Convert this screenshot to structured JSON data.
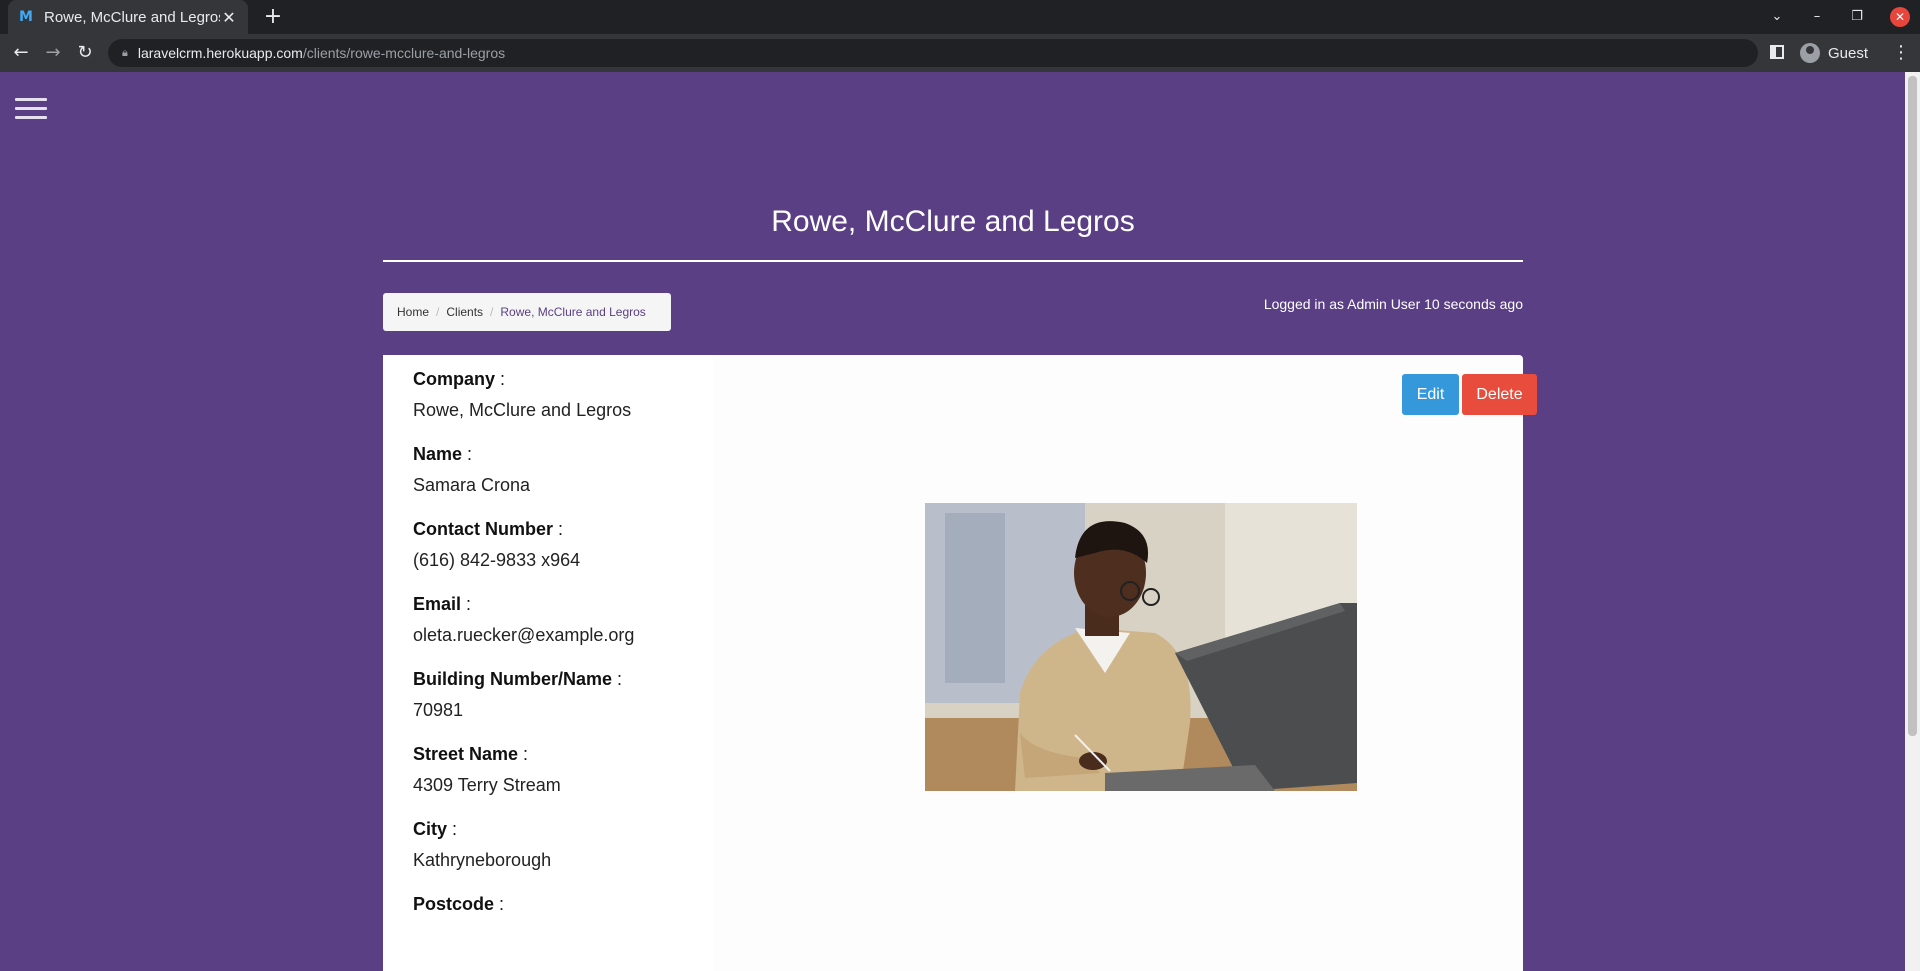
{
  "browser": {
    "tab_title": "Rowe, McClure and Legros",
    "favicon": "M",
    "url_host": "laravelcrm.herokuapp.com",
    "url_path": "/clients/rowe-mcclure-and-legros",
    "profile_name": "Guest"
  },
  "page": {
    "title": "Rowe, McClure and Legros",
    "breadcrumb": [
      {
        "label": "Home"
      },
      {
        "label": "Clients"
      },
      {
        "label": "Rowe, McClure and Legros"
      }
    ],
    "login_status": "Logged in as Admin User 10 seconds ago"
  },
  "client": {
    "fields": [
      {
        "label": "Company",
        "value": "Rowe, McClure and Legros"
      },
      {
        "label": "Name",
        "value": "Samara Crona"
      },
      {
        "label": "Contact Number",
        "value": "(616) 842-9833 x964"
      },
      {
        "label": "Email",
        "value": "oleta.ruecker@example.org"
      },
      {
        "label": "Building Number/Name",
        "value": "70981"
      },
      {
        "label": "Street Name",
        "value": "4309 Terry Stream"
      },
      {
        "label": "City",
        "value": "Kathryneborough"
      },
      {
        "label": "Postcode",
        "value": ""
      }
    ],
    "edit_label": "Edit",
    "delete_label": "Delete"
  },
  "colors": {
    "page_bg": "#5a3f84",
    "edit": "#3498db",
    "delete": "#e74c3c"
  }
}
